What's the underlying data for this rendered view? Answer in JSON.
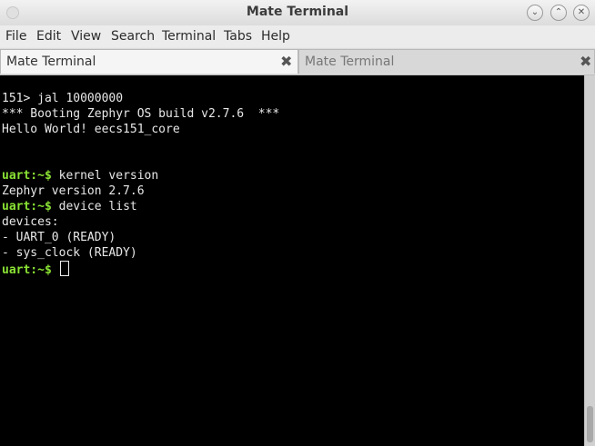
{
  "window": {
    "title": "Mate Terminal"
  },
  "menu": [
    "File",
    "Edit",
    "View",
    "Search",
    "Terminal",
    "Tabs",
    "Help"
  ],
  "tabs": [
    {
      "label": "Mate Terminal",
      "active": true
    },
    {
      "label": "Mate Terminal",
      "active": false
    }
  ],
  "terminal": {
    "prompt": "uart:~$",
    "lines": {
      "l1": "151> jal 10000000",
      "l2": "*** Booting Zephyr OS build v2.7.6  ***",
      "l3": "Hello World! eecs151_core",
      "cmd1": "kernel version",
      "l5": "Zephyr version 2.7.6",
      "cmd2": "device list",
      "l7": "devices:",
      "l8": "- UART_0 (READY)",
      "l9": "- sys_clock (READY)"
    }
  },
  "colors": {
    "prompt": "#8ae234",
    "terminal_bg": "#000000",
    "terminal_fg": "#e8e8e8"
  }
}
